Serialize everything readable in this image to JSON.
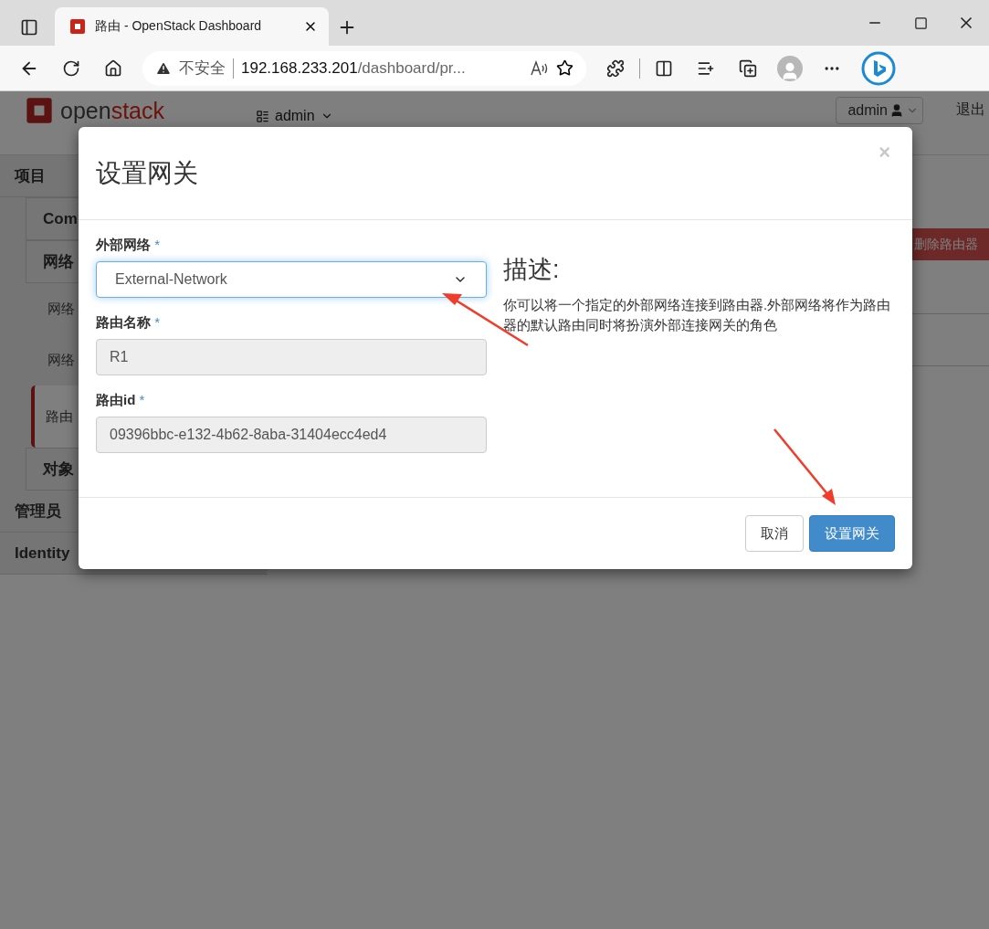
{
  "browser": {
    "tab_title": "路由 - OpenStack Dashboard",
    "security_label": "不安全",
    "url_host": "192.168.233.201",
    "url_path": "/dashboard/pr..."
  },
  "header": {
    "logo_left": "open",
    "logo_right": "stack",
    "project_menu": "admin",
    "user_menu": "admin",
    "logout": "退出"
  },
  "sidebar": [
    {
      "label": "项目",
      "children": [
        {
          "label": "Com"
        },
        {
          "label": "网络",
          "children": [
            {
              "label": "网络",
              "selected": false
            },
            {
              "label": "网络",
              "selected": false
            },
            {
              "label": "路由",
              "selected": true
            }
          ]
        },
        {
          "label": "对象"
        }
      ]
    },
    {
      "label": "管理员"
    },
    {
      "label": "Identity"
    }
  ],
  "toolbar": {
    "delete_button": "删除路由器"
  },
  "dialog": {
    "title": "设置网关",
    "close": "×",
    "fields": [
      {
        "label": "外部网络",
        "required_mark": "*",
        "kind": "select",
        "value": "External-Network",
        "focused": true
      },
      {
        "label": "路由名称",
        "required_mark": "*",
        "kind": "readonly",
        "value": "R1",
        "focused": false
      },
      {
        "label": "路由id",
        "required_mark": "*",
        "kind": "readonly",
        "value": "09396bbc-e132-4b62-8aba-31404ecc4ed4",
        "focused": false
      }
    ],
    "description_title": "描述:",
    "description": "你可以将一个指定的外部网络连接到路由器.外部网络将作为路由器的默认路由同时将扮演外部连接网关的角色",
    "buttons": [
      {
        "label": "取消",
        "primary": false
      },
      {
        "label": "设置网关",
        "primary": true
      }
    ]
  }
}
